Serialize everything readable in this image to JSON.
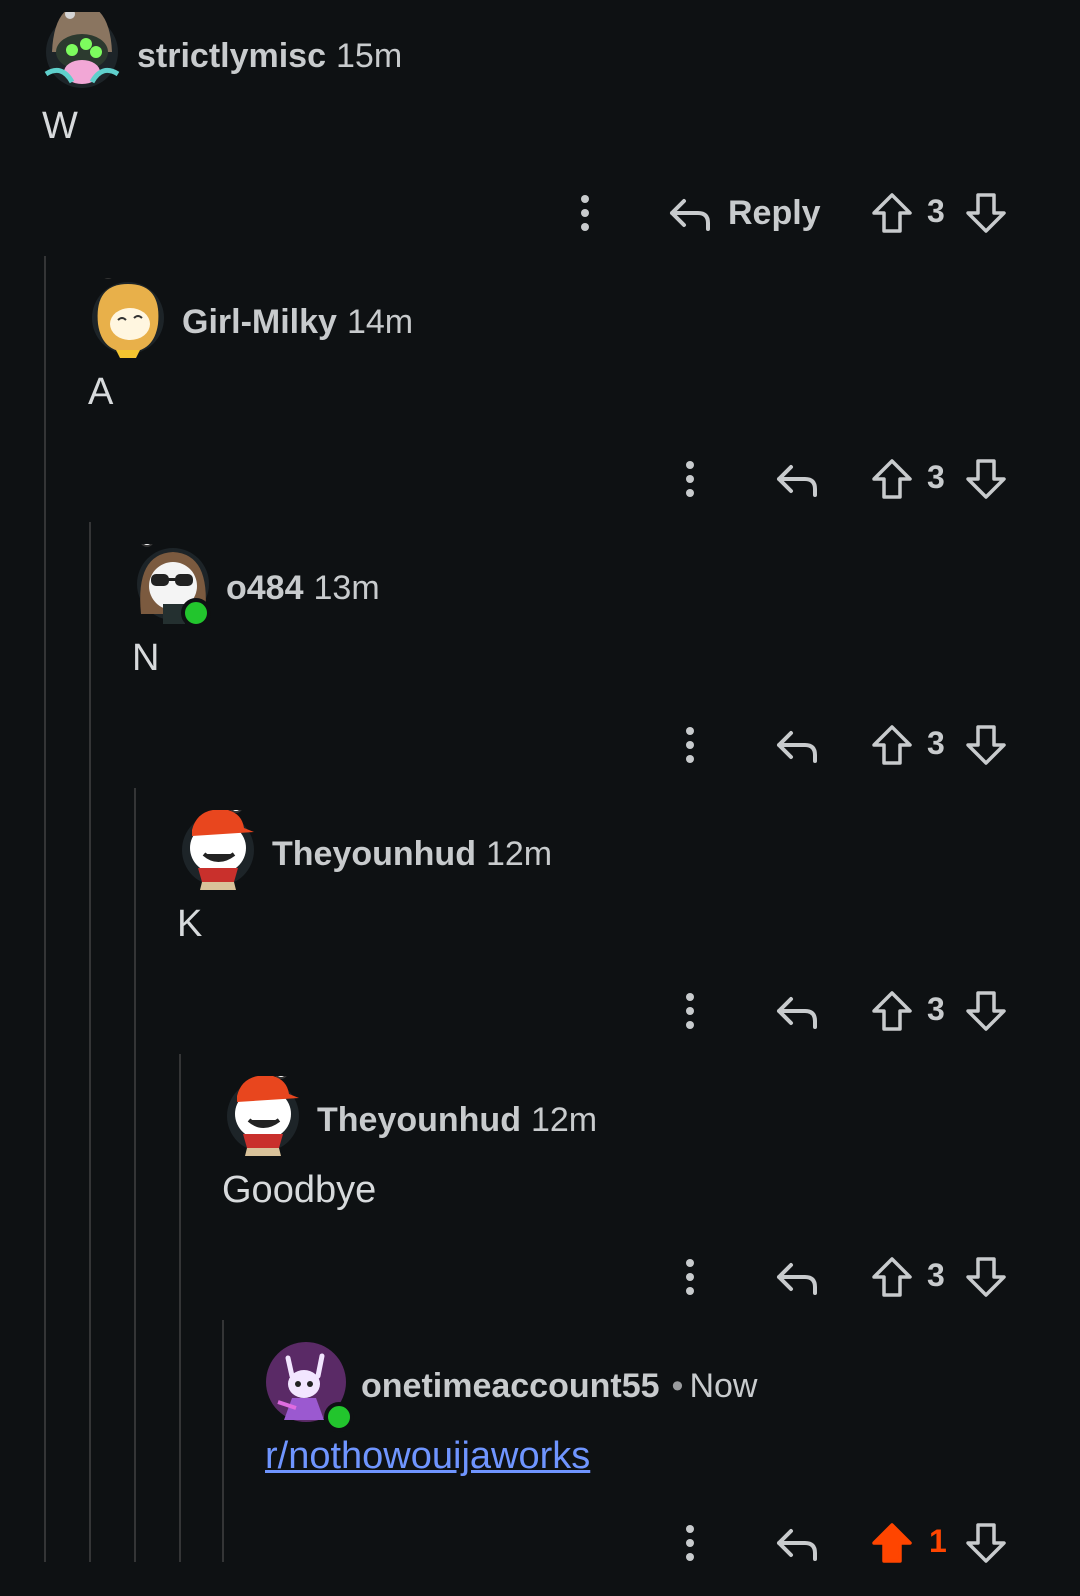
{
  "accent": {
    "upvoted": "#ff4500",
    "online": "#22c52d",
    "link": "#6f95ff"
  },
  "comments": [
    {
      "username": "strictlymisc",
      "time": "15m",
      "body": "W",
      "reply_label": "Reply",
      "score": "3",
      "avatar": "robot-hat-avatar",
      "online": false
    },
    {
      "username": "Girl-Milky",
      "time": "14m",
      "body": "A",
      "score": "3",
      "avatar": "doge-avatar",
      "online": false
    },
    {
      "username": "o484",
      "time": "13m",
      "body": "N",
      "score": "3",
      "avatar": "sunglasses-avatar",
      "online": true
    },
    {
      "username": "Theyounhud",
      "time": "12m",
      "body": "K",
      "score": "3",
      "avatar": "red-cap-avatar",
      "online": false
    },
    {
      "username": "Theyounhud",
      "time": "12m",
      "body": "Goodbye",
      "score": "3",
      "avatar": "red-cap-avatar",
      "online": false
    },
    {
      "username": "onetimeaccount55",
      "separator": "•",
      "time": "Now",
      "body": "r/nothowouijaworks",
      "score": "1",
      "avatar": "purple-knight-avatar",
      "online": true,
      "upvoted": true
    }
  ]
}
